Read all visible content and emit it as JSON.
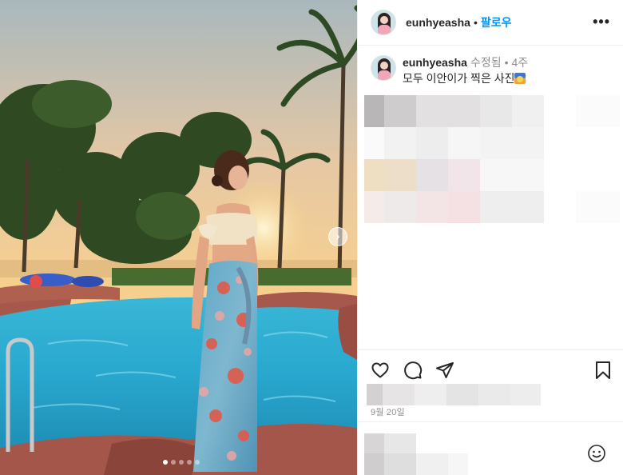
{
  "post": {
    "username": "eunhyeasha",
    "separator": "•",
    "follow_label": "팔로우",
    "more_label": "•••",
    "caption": {
      "username": "eunhyeasha",
      "edited": "수정됨",
      "dot": "•",
      "age": "4주",
      "text": "모두 이안이가 찍은 사진"
    },
    "date": "9월 20일",
    "carousel": {
      "slides": 5,
      "active_index": 0
    }
  },
  "icons": {
    "like": "heart-icon",
    "comment": "comment-icon",
    "share": "send-icon",
    "save": "bookmark-icon",
    "next": "chevron-right-icon",
    "emoji": "smiley-icon",
    "more": "more-icon"
  },
  "colors": {
    "accent": "#0095f6",
    "text": "#262626",
    "muted": "#8e8e8e",
    "border": "#efefef"
  }
}
